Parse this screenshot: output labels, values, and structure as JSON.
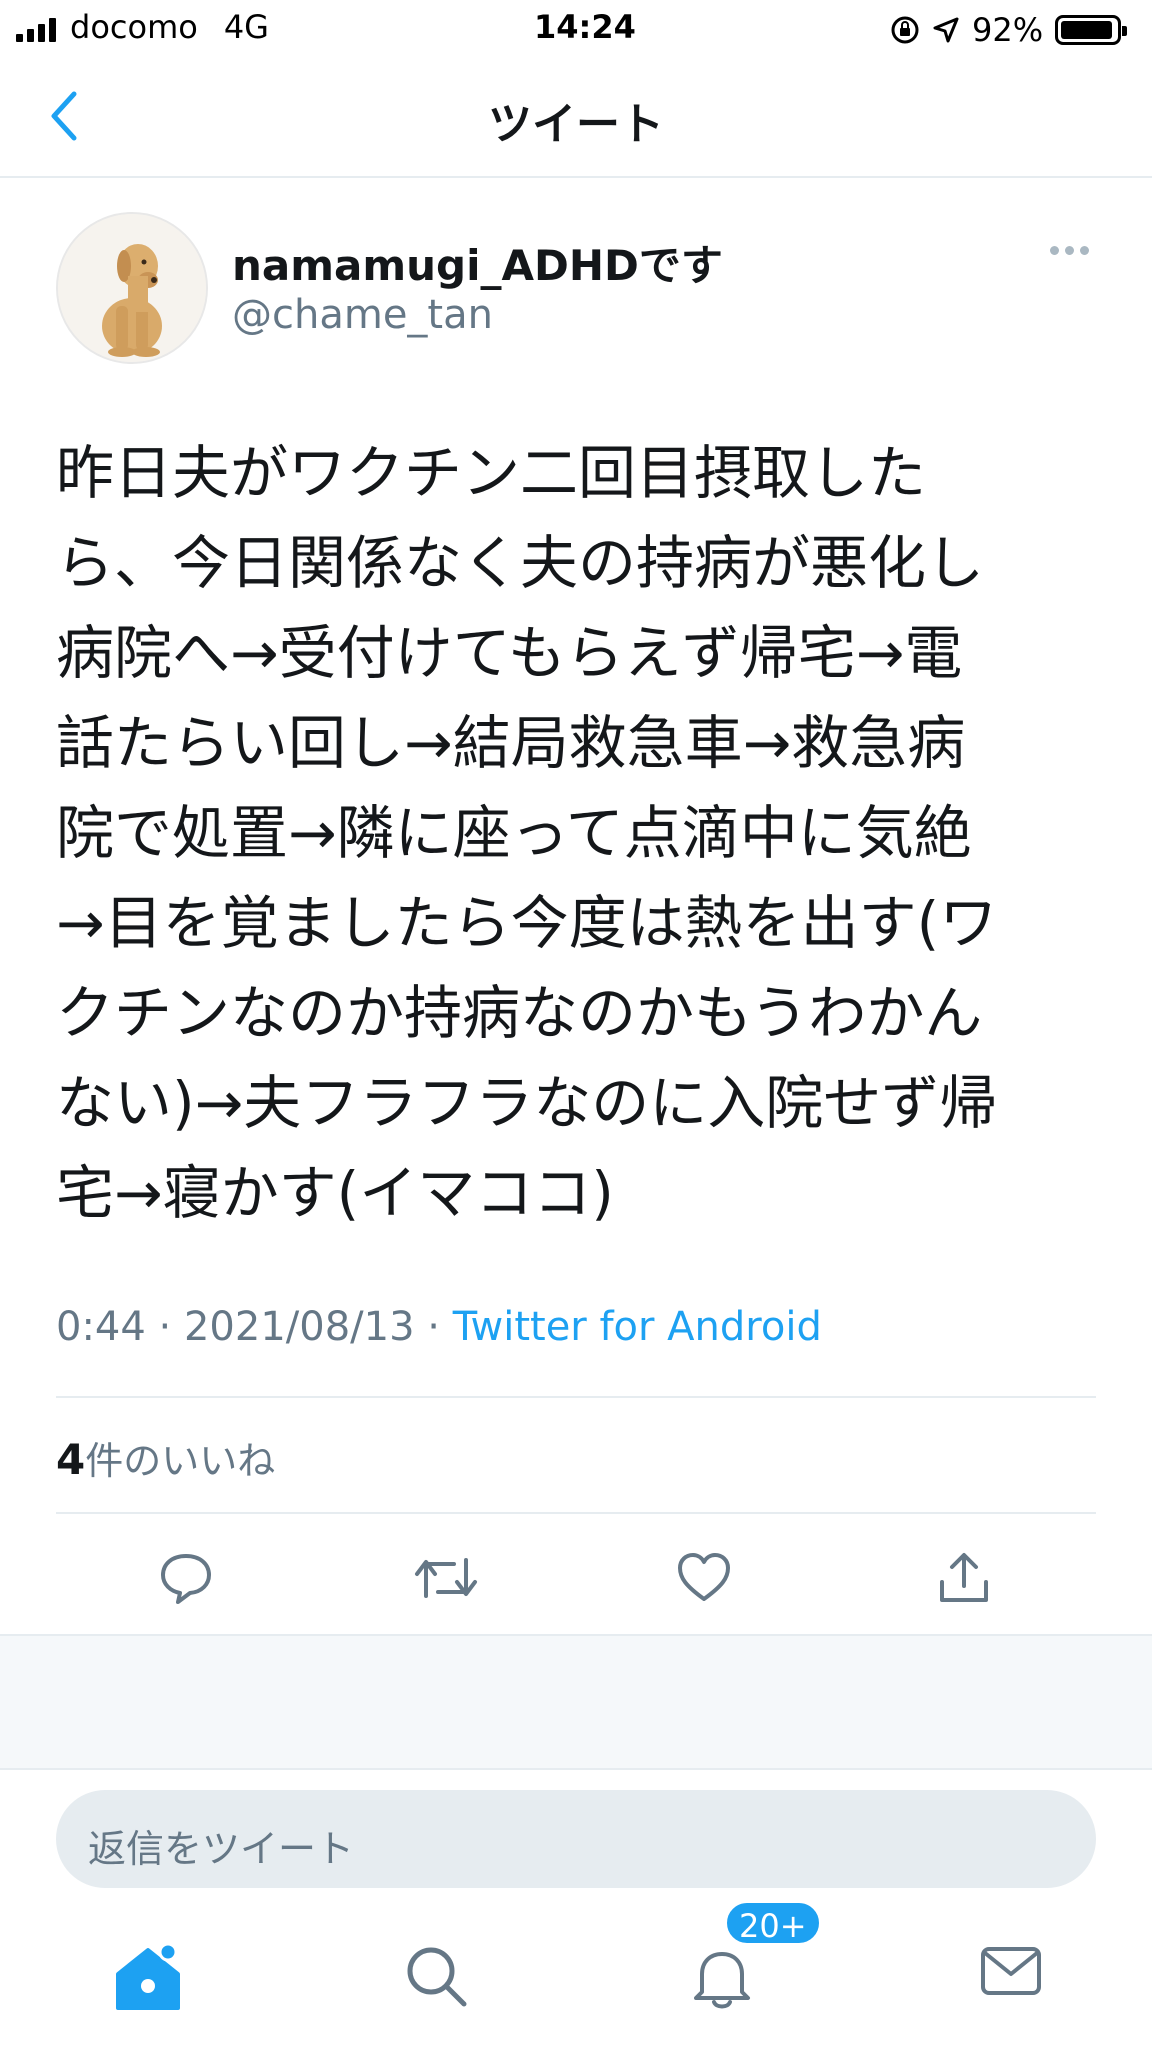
{
  "status_bar": {
    "carrier": "docomo",
    "network": "4G",
    "time": "14:24",
    "battery": "92%",
    "battery_level": 0.92
  },
  "nav": {
    "title": "ツイート",
    "back_icon": "chevron-left-icon"
  },
  "tweet": {
    "display_name": "namamugi_ADHDです",
    "handle": "@chame_tan",
    "text": "昨日夫がワクチン二回目摂取した\nら、今日関係なく夫の持病が悪化し\n病院へ→受付けてもらえず帰宅→電\n話たらい回し→結局救急車→救急病\n院で処置→隣に座って点滴中に気絶\n→目を覚ましたら今度は熱を出す(ワ\nクチンなのか持病なのかもうわかん\nない)→夫フラフラなのに入院せず帰\n宅→寝かす(イマココ)",
    "time": "0:44",
    "date": "2021/08/13",
    "separator": " · ",
    "source": "Twitter for Android",
    "likes_count": "4",
    "likes_label": "件のいいね"
  },
  "actions": [
    "reply-icon",
    "retweet-icon",
    "like-icon",
    "share-icon"
  ],
  "reply": {
    "placeholder": "返信をツイート"
  },
  "tabbar": {
    "items": [
      "home-icon",
      "search-icon",
      "notifications-icon",
      "messages-icon"
    ],
    "notification_badge": "20+"
  },
  "colors": {
    "accent": "#1da1f2",
    "secondary_text": "#657786",
    "divider": "#e6ecf0"
  }
}
